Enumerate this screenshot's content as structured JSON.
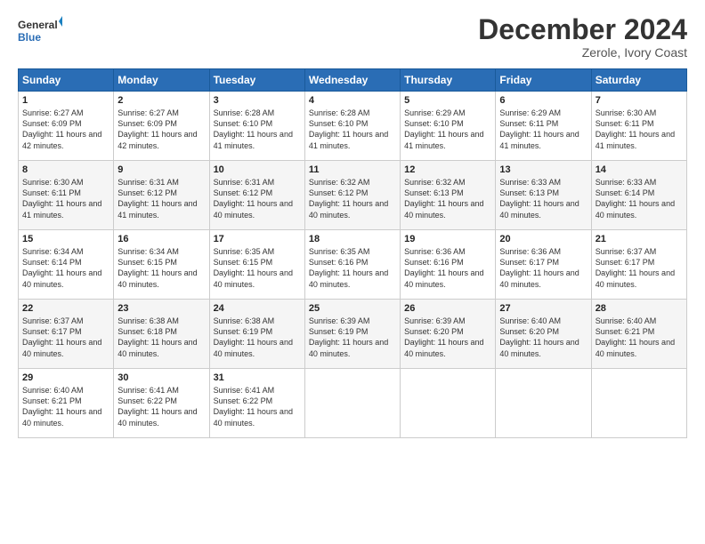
{
  "logo": {
    "line1": "General",
    "line2": "Blue"
  },
  "title": "December 2024",
  "subtitle": "Zerole, Ivory Coast",
  "days_header": [
    "Sunday",
    "Monday",
    "Tuesday",
    "Wednesday",
    "Thursday",
    "Friday",
    "Saturday"
  ],
  "weeks": [
    [
      {
        "day": "1",
        "sunrise": "6:27 AM",
        "sunset": "6:09 PM",
        "daylight": "11 hours and 42 minutes."
      },
      {
        "day": "2",
        "sunrise": "6:27 AM",
        "sunset": "6:09 PM",
        "daylight": "11 hours and 42 minutes."
      },
      {
        "day": "3",
        "sunrise": "6:28 AM",
        "sunset": "6:10 PM",
        "daylight": "11 hours and 41 minutes."
      },
      {
        "day": "4",
        "sunrise": "6:28 AM",
        "sunset": "6:10 PM",
        "daylight": "11 hours and 41 minutes."
      },
      {
        "day": "5",
        "sunrise": "6:29 AM",
        "sunset": "6:10 PM",
        "daylight": "11 hours and 41 minutes."
      },
      {
        "day": "6",
        "sunrise": "6:29 AM",
        "sunset": "6:11 PM",
        "daylight": "11 hours and 41 minutes."
      },
      {
        "day": "7",
        "sunrise": "6:30 AM",
        "sunset": "6:11 PM",
        "daylight": "11 hours and 41 minutes."
      }
    ],
    [
      {
        "day": "8",
        "sunrise": "6:30 AM",
        "sunset": "6:11 PM",
        "daylight": "11 hours and 41 minutes."
      },
      {
        "day": "9",
        "sunrise": "6:31 AM",
        "sunset": "6:12 PM",
        "daylight": "11 hours and 41 minutes."
      },
      {
        "day": "10",
        "sunrise": "6:31 AM",
        "sunset": "6:12 PM",
        "daylight": "11 hours and 40 minutes."
      },
      {
        "day": "11",
        "sunrise": "6:32 AM",
        "sunset": "6:12 PM",
        "daylight": "11 hours and 40 minutes."
      },
      {
        "day": "12",
        "sunrise": "6:32 AM",
        "sunset": "6:13 PM",
        "daylight": "11 hours and 40 minutes."
      },
      {
        "day": "13",
        "sunrise": "6:33 AM",
        "sunset": "6:13 PM",
        "daylight": "11 hours and 40 minutes."
      },
      {
        "day": "14",
        "sunrise": "6:33 AM",
        "sunset": "6:14 PM",
        "daylight": "11 hours and 40 minutes."
      }
    ],
    [
      {
        "day": "15",
        "sunrise": "6:34 AM",
        "sunset": "6:14 PM",
        "daylight": "11 hours and 40 minutes."
      },
      {
        "day": "16",
        "sunrise": "6:34 AM",
        "sunset": "6:15 PM",
        "daylight": "11 hours and 40 minutes."
      },
      {
        "day": "17",
        "sunrise": "6:35 AM",
        "sunset": "6:15 PM",
        "daylight": "11 hours and 40 minutes."
      },
      {
        "day": "18",
        "sunrise": "6:35 AM",
        "sunset": "6:16 PM",
        "daylight": "11 hours and 40 minutes."
      },
      {
        "day": "19",
        "sunrise": "6:36 AM",
        "sunset": "6:16 PM",
        "daylight": "11 hours and 40 minutes."
      },
      {
        "day": "20",
        "sunrise": "6:36 AM",
        "sunset": "6:17 PM",
        "daylight": "11 hours and 40 minutes."
      },
      {
        "day": "21",
        "sunrise": "6:37 AM",
        "sunset": "6:17 PM",
        "daylight": "11 hours and 40 minutes."
      }
    ],
    [
      {
        "day": "22",
        "sunrise": "6:37 AM",
        "sunset": "6:17 PM",
        "daylight": "11 hours and 40 minutes."
      },
      {
        "day": "23",
        "sunrise": "6:38 AM",
        "sunset": "6:18 PM",
        "daylight": "11 hours and 40 minutes."
      },
      {
        "day": "24",
        "sunrise": "6:38 AM",
        "sunset": "6:19 PM",
        "daylight": "11 hours and 40 minutes."
      },
      {
        "day": "25",
        "sunrise": "6:39 AM",
        "sunset": "6:19 PM",
        "daylight": "11 hours and 40 minutes."
      },
      {
        "day": "26",
        "sunrise": "6:39 AM",
        "sunset": "6:20 PM",
        "daylight": "11 hours and 40 minutes."
      },
      {
        "day": "27",
        "sunrise": "6:40 AM",
        "sunset": "6:20 PM",
        "daylight": "11 hours and 40 minutes."
      },
      {
        "day": "28",
        "sunrise": "6:40 AM",
        "sunset": "6:21 PM",
        "daylight": "11 hours and 40 minutes."
      }
    ],
    [
      {
        "day": "29",
        "sunrise": "6:40 AM",
        "sunset": "6:21 PM",
        "daylight": "11 hours and 40 minutes."
      },
      {
        "day": "30",
        "sunrise": "6:41 AM",
        "sunset": "6:22 PM",
        "daylight": "11 hours and 40 minutes."
      },
      {
        "day": "31",
        "sunrise": "6:41 AM",
        "sunset": "6:22 PM",
        "daylight": "11 hours and 40 minutes."
      },
      null,
      null,
      null,
      null
    ]
  ],
  "labels": {
    "sunrise": "Sunrise: ",
    "sunset": "Sunset: ",
    "daylight": "Daylight: "
  }
}
